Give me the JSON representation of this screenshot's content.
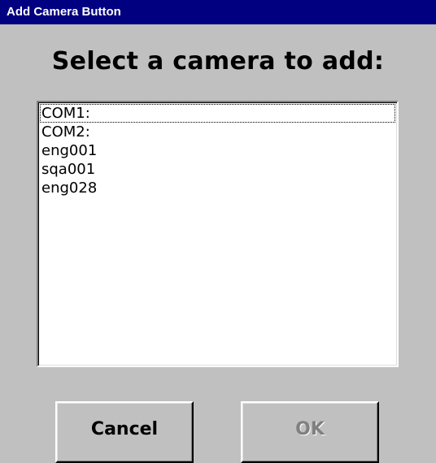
{
  "window": {
    "title": "Add Camera Button"
  },
  "prompt": "Select a camera to add:",
  "camera_list": {
    "items": [
      "COM1:",
      "COM2:",
      "eng001",
      "sqa001",
      "eng028"
    ],
    "focused_index": 0
  },
  "buttons": {
    "cancel_label": "Cancel",
    "ok_label": "OK",
    "ok_enabled": false
  },
  "colors": {
    "title_bar": "#000080",
    "dialog_background": "#c0c0c0",
    "list_background": "#ffffff",
    "disabled_text": "#808080"
  }
}
